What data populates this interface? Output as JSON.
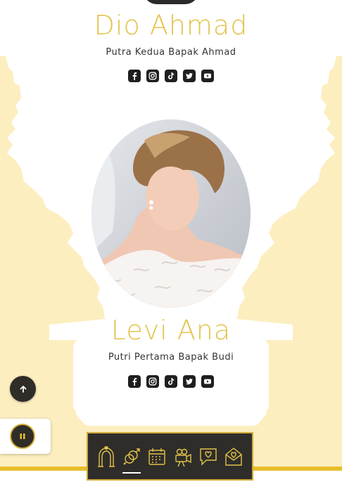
{
  "groom": {
    "name": "Dio Ahmad",
    "description": "Putra Kedua Bapak Ahmad",
    "socials": [
      "facebook-icon",
      "instagram-icon",
      "tiktok-icon",
      "twitter-icon",
      "youtube-icon"
    ]
  },
  "bride": {
    "name": "Levi Ana",
    "description": "Putri Pertama Bapak Budi",
    "socials": [
      "facebook-icon",
      "instagram-icon",
      "tiktok-icon",
      "twitter-icon",
      "youtube-icon"
    ]
  },
  "floating": {
    "scroll_top_icon": "arrow-up-icon",
    "music_icon": "pause-icon"
  },
  "bottom_nav": {
    "items": [
      "wedding-arch-icon",
      "couple-icon",
      "calendar-icon",
      "video-camera-icon",
      "chat-heart-icon",
      "love-letter-icon"
    ],
    "active_index": 1
  },
  "colors": {
    "gold": "#e2c24a",
    "cream": "#fdeec0",
    "dark": "#2e2d2a",
    "nav_border": "#d1a93a"
  }
}
